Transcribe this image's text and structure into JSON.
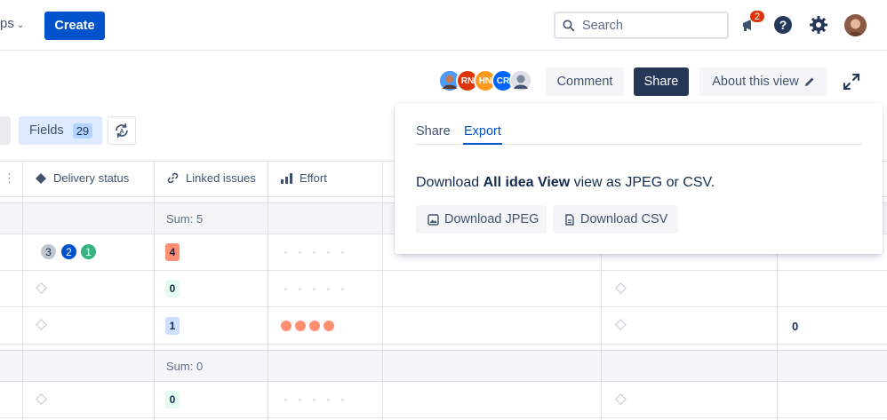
{
  "nav": {
    "apps_label": "ps",
    "create_label": "Create",
    "search_placeholder": "Search",
    "notification_count": "2"
  },
  "view_header": {
    "collaborators": [
      {
        "initials": "",
        "color": "#8c6e58"
      },
      {
        "initials": "RN",
        "color": "#de350b"
      },
      {
        "initials": "HN",
        "color": "#ff991f"
      },
      {
        "initials": "CR",
        "color": "#0065ff"
      },
      {
        "initials": "",
        "color": "#a5adba"
      }
    ],
    "comment_label": "Comment",
    "share_label": "Share",
    "about_label": "About this view"
  },
  "toolbar": {
    "fields_label": "Fields",
    "fields_count": "29"
  },
  "table": {
    "columns": [
      {
        "label": "Delivery status",
        "icon": "diamond-icon"
      },
      {
        "label": "Linked issues",
        "icon": "link-icon"
      },
      {
        "label": "Effort",
        "icon": "bar-chart-icon"
      }
    ],
    "groups": [
      {
        "sum_label": "Sum: 5"
      },
      {
        "sum_label": "Sum: 0"
      }
    ],
    "rows": [
      {
        "delivery": [
          "3",
          "2",
          "1"
        ],
        "linked": "4",
        "effort_filled": 0
      },
      {
        "delivery": [],
        "linked": "0",
        "effort_filled": 0
      },
      {
        "delivery": [],
        "linked": "1",
        "effort_filled": 4,
        "extra_value": "0"
      },
      {
        "delivery": [],
        "linked": "0",
        "effort_filled": 0
      }
    ]
  },
  "popup": {
    "tab_share": "Share",
    "tab_export": "Export",
    "text_prefix": "Download ",
    "view_name": "All idea View",
    "text_suffix": " view as JPEG or CSV.",
    "download_jpeg": "Download JPEG",
    "download_csv": "Download CSV"
  },
  "colors": {
    "primary": "#0052cc",
    "share_dark": "#253858",
    "lozenge_red": "#ff8f73",
    "lozenge_green": "#e3fcef",
    "lozenge_blue": "#cce0ff"
  }
}
